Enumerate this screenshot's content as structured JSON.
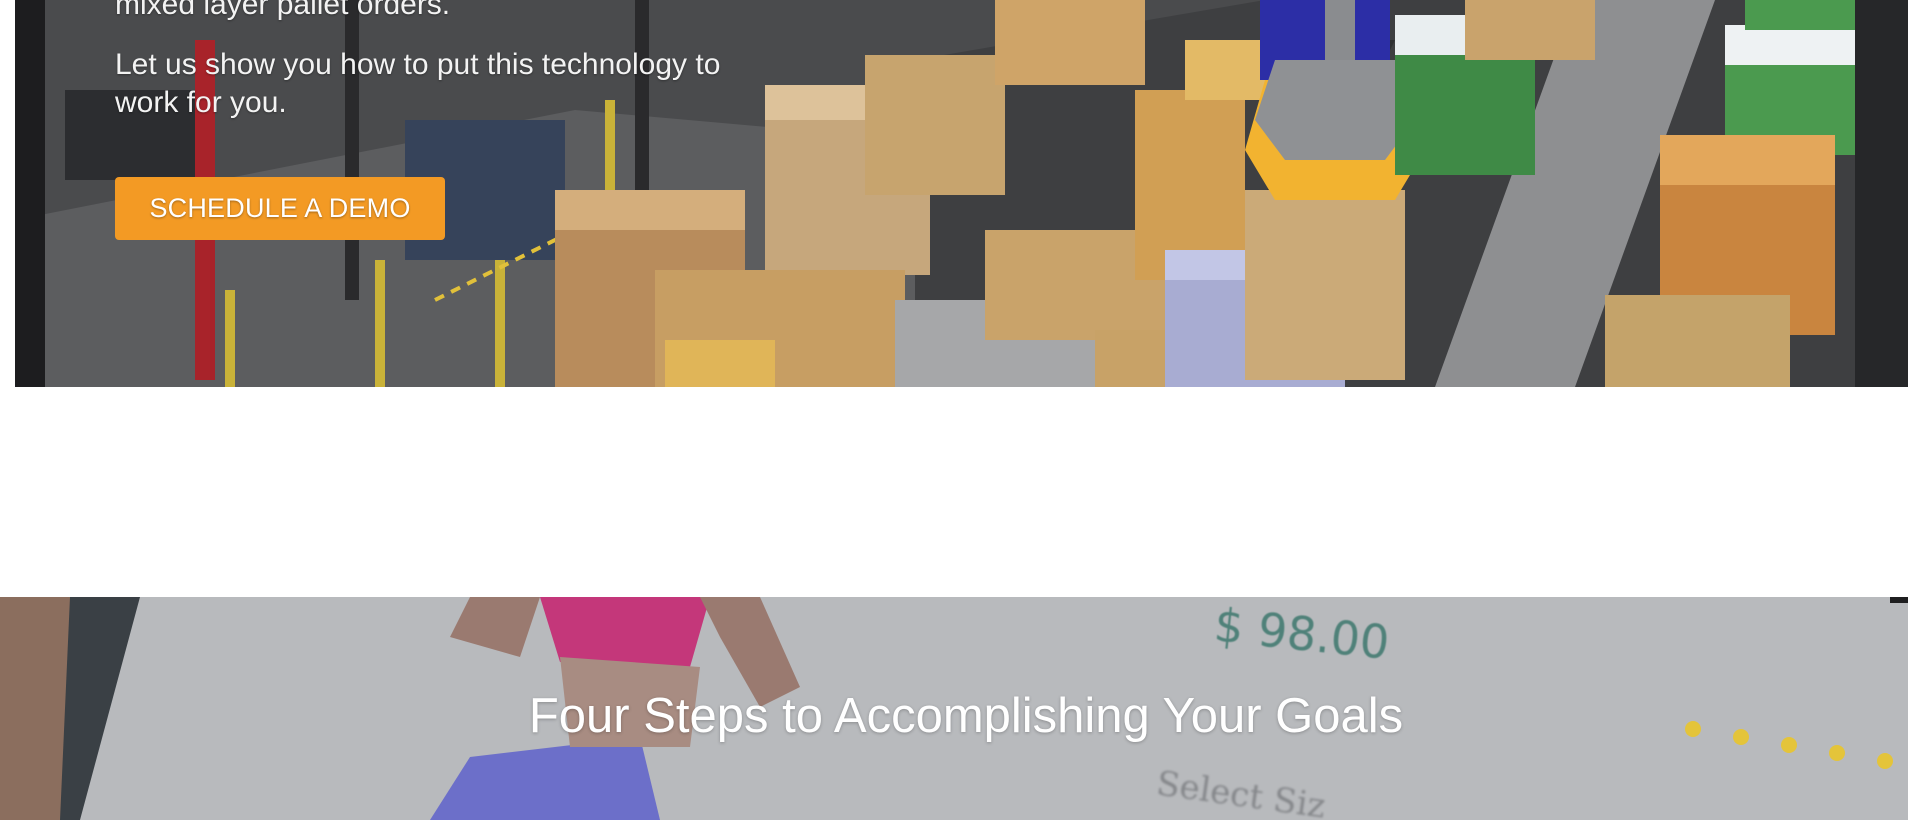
{
  "hero": {
    "partial_text": "mixed layer pallet orders.",
    "cta_text": "Let us show you how to put this technology to work for you.",
    "demo_button": "SCHEDULE A DEMO"
  },
  "steps_section": {
    "title": "Four Steps to Accomplishing Your Goals",
    "background_price": "$ 98.00",
    "background_select": "Select Siz"
  },
  "colors": {
    "accent_orange": "#f39a24",
    "hero_text": "#f3f3f3",
    "section_title": "#ffffff"
  }
}
